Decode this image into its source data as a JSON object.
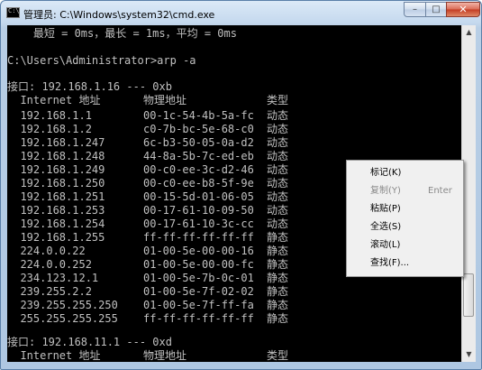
{
  "window": {
    "title": "管理员: C:\\Windows\\system32\\cmd.exe",
    "icon_text": "C:\\",
    "buttons": {
      "minimize": "–",
      "maximize": "□",
      "close": "✕"
    }
  },
  "console": {
    "stats_line": "    最短 = 0ms，最长 = 1ms，平均 = 0ms",
    "prompt_line": "C:\\Users\\Administrator>arp -a",
    "interface1": "接口: 192.168.1.16 --- 0xb",
    "headers": {
      "address": "  Internet 地址",
      "physical": "物理地址",
      "type": "类型"
    },
    "entries": [
      {
        "ip": "  192.168.1.1",
        "mac": "00-1c-54-4b-5a-fc",
        "type": "动态"
      },
      {
        "ip": "  192.168.1.2",
        "mac": "c0-7b-bc-5e-68-c0",
        "type": "动态"
      },
      {
        "ip": "  192.168.1.247",
        "mac": "6c-b3-50-05-0a-d2",
        "type": "动态"
      },
      {
        "ip": "  192.168.1.248",
        "mac": "44-8a-5b-7c-ed-eb",
        "type": "动态"
      },
      {
        "ip": "  192.168.1.249",
        "mac": "00-c0-ee-3c-d2-46",
        "type": "动态"
      },
      {
        "ip": "  192.168.1.250",
        "mac": "00-c0-ee-b8-5f-9e",
        "type": "动态"
      },
      {
        "ip": "  192.168.1.251",
        "mac": "00-15-5d-01-06-05",
        "type": "动态"
      },
      {
        "ip": "  192.168.1.253",
        "mac": "00-17-61-10-09-50",
        "type": "动态"
      },
      {
        "ip": "  192.168.1.254",
        "mac": "00-17-61-10-3c-cc",
        "type": "动态"
      },
      {
        "ip": "  192.168.1.255",
        "mac": "ff-ff-ff-ff-ff-ff",
        "type": "静态"
      },
      {
        "ip": "  224.0.0.22",
        "mac": "01-00-5e-00-00-16",
        "type": "静态"
      },
      {
        "ip": "  224.0.0.252",
        "mac": "01-00-5e-00-00-fc",
        "type": "静态"
      },
      {
        "ip": "  234.123.12.1",
        "mac": "01-00-5e-7b-0c-01",
        "type": "静态"
      },
      {
        "ip": "  239.255.2.2",
        "mac": "01-00-5e-7f-02-02",
        "type": "静态"
      },
      {
        "ip": "  239.255.255.250",
        "mac": "01-00-5e-7f-ff-fa",
        "type": "静态"
      },
      {
        "ip": "  255.255.255.255",
        "mac": "ff-ff-ff-ff-ff-ff",
        "type": "静态"
      }
    ],
    "interface2": "接口: 192.168.11.1 --- 0xd",
    "headers2": {
      "address": "  Internet 地址",
      "physical": "物理地址",
      "type": "类型"
    },
    "text_color": "#c0c0c0",
    "background": "#000000"
  },
  "scrollbar": {
    "up": "▲",
    "down": "▼"
  },
  "context_menu": {
    "items": [
      {
        "label": "标记(K)",
        "shortcut": "",
        "enabled": true
      },
      {
        "label": "复制(Y)",
        "shortcut": "Enter",
        "enabled": false
      },
      {
        "label": "粘贴(P)",
        "shortcut": "",
        "enabled": true
      },
      {
        "label": "全选(S)",
        "shortcut": "",
        "enabled": true
      },
      {
        "label": "滚动(L)",
        "shortcut": "",
        "enabled": true
      },
      {
        "label": "查找(F)...",
        "shortcut": "",
        "enabled": true
      }
    ]
  }
}
